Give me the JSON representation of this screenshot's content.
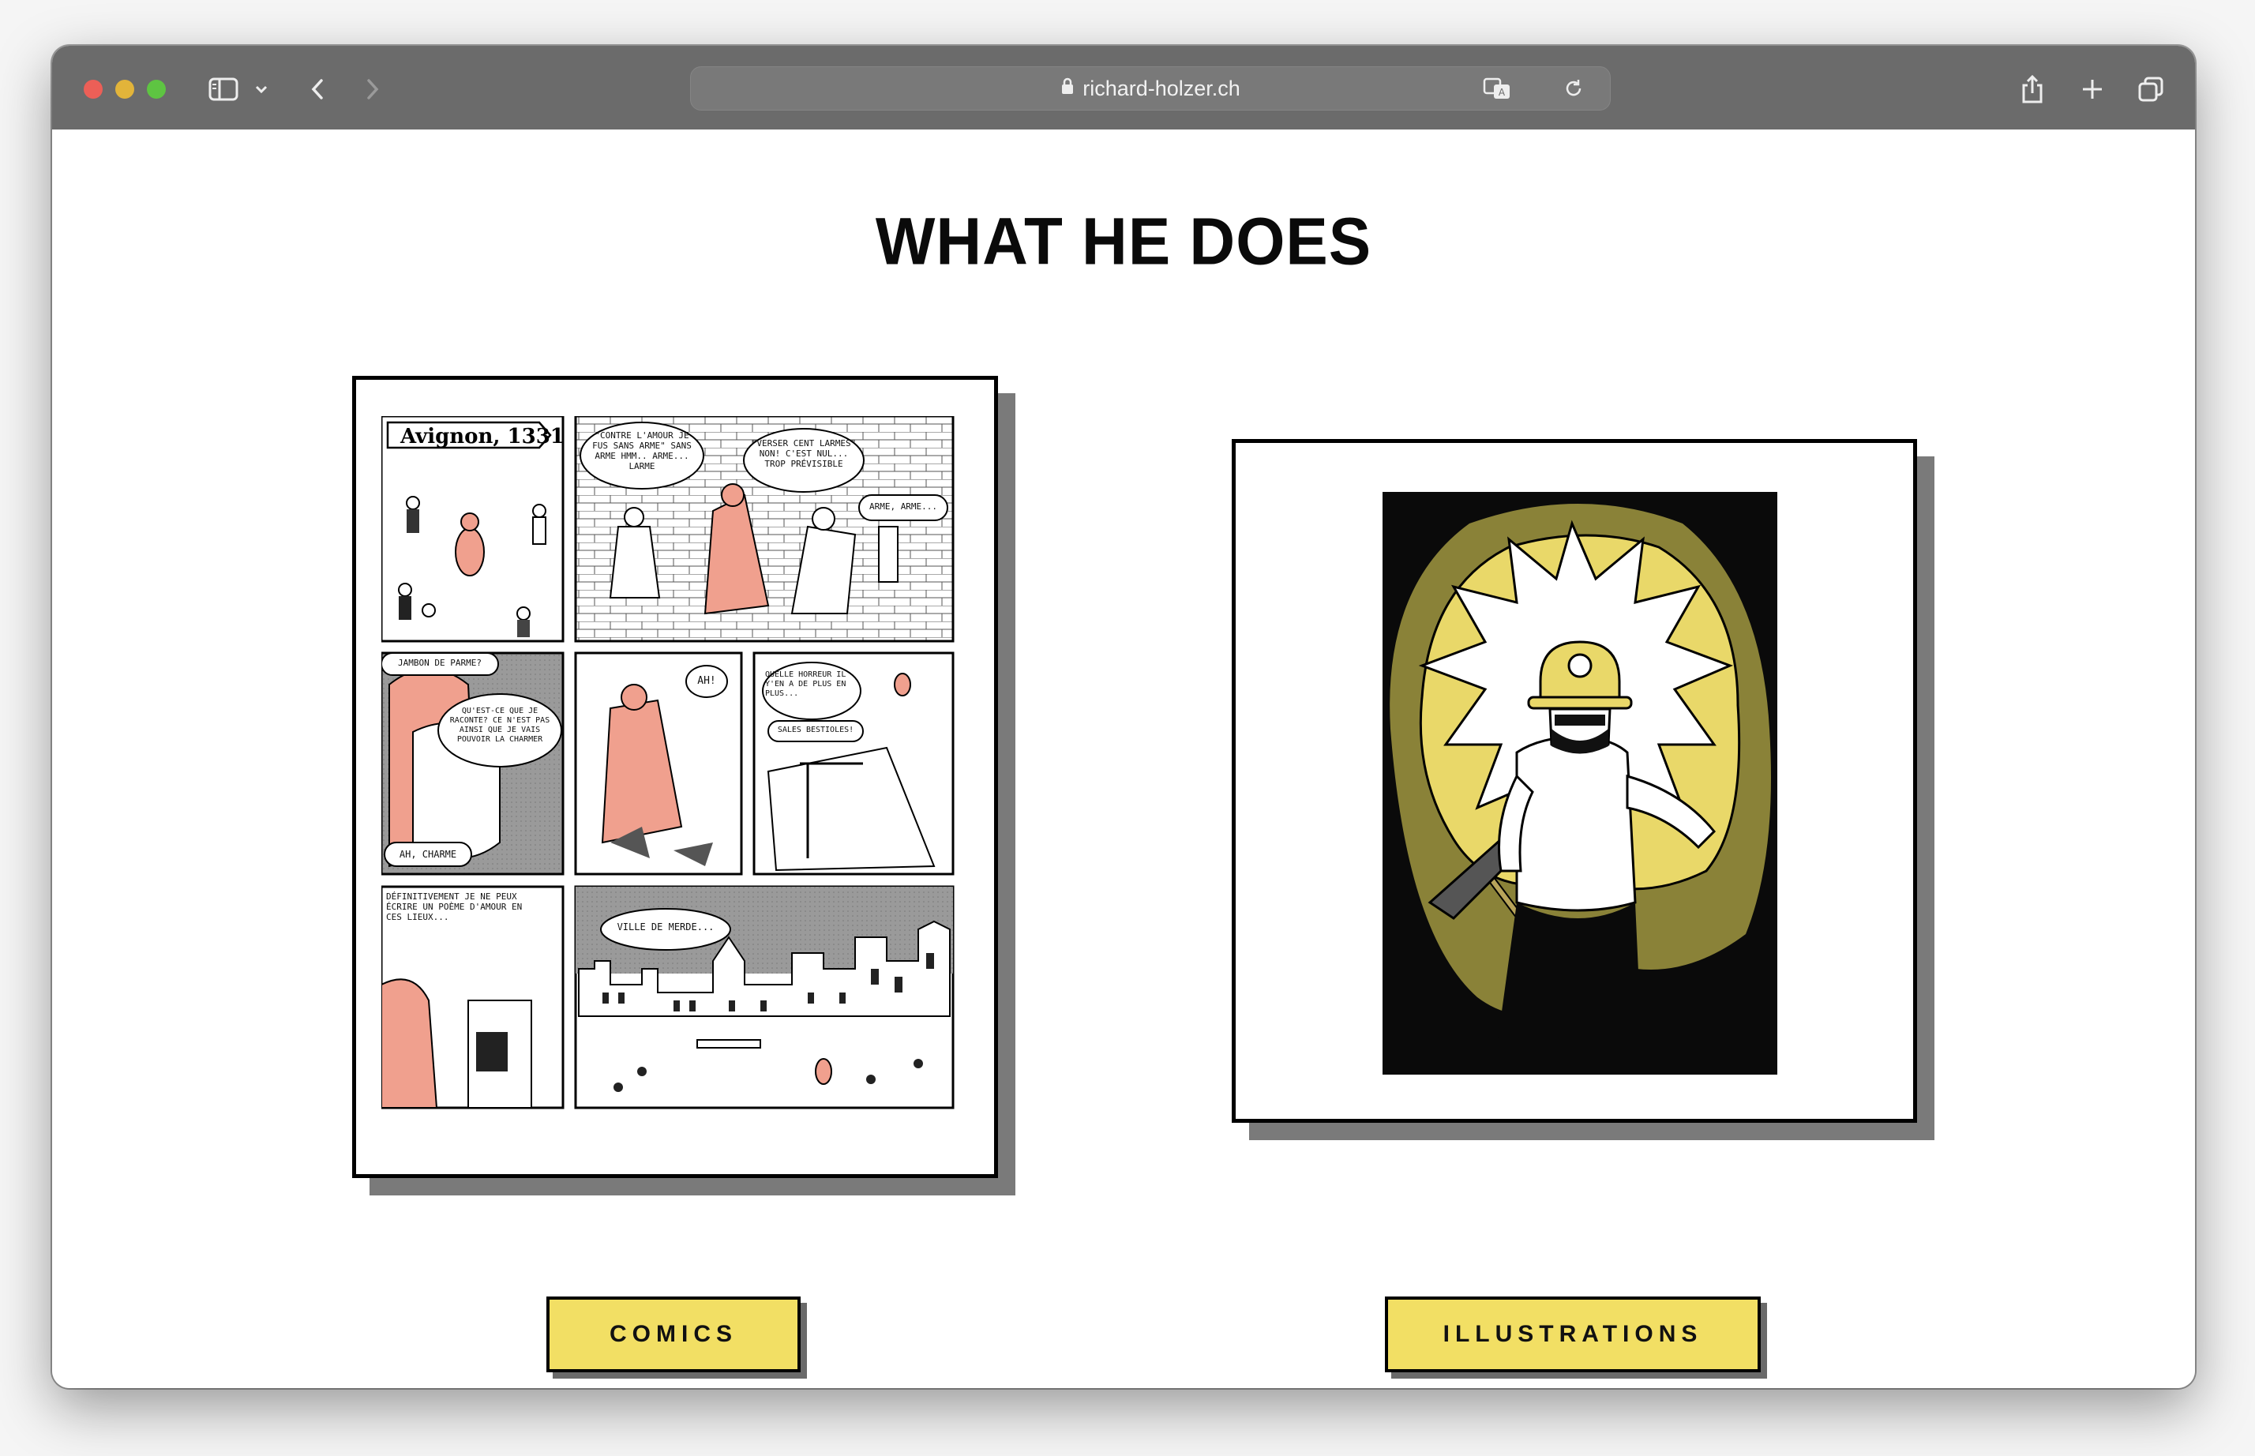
{
  "browser": {
    "url": "richard-holzer.ch",
    "icons": [
      "sidebar-icon",
      "chevron-down-icon",
      "back-icon",
      "forward-icon",
      "lock-icon",
      "translate-icon",
      "reload-icon",
      "share-icon",
      "plus-icon",
      "tabs-icon"
    ]
  },
  "page": {
    "heading": "WHAT HE DOES",
    "comics": {
      "button_label": "COMICS",
      "panel_texts": {
        "title": "Avignon, 1331",
        "bubble1": "\"CONTRE L'AMOUR JE FUS SANS ARME\" SANS ARME HMM.. ARME... LARME",
        "bubble2": "\"VERSER CENT LARMES\" NON! C'EST NUL... TROP PRÉVISIBLE",
        "bubble3": "ARME, ARME...",
        "bubble4": "JAMBON DE PARME?",
        "bubble5": "QU'EST-CE QUE JE RACONTE? CE N'EST PAS AINSI QUE JE VAIS POUVOIR LA CHARMER",
        "bubble6": "AH!",
        "bubble7": "QUELLE HORREUR IL Y'EN A DE PLUS EN PLUS...",
        "bubble8": "SALES BESTIOLES!",
        "bubble9": "AH, CHARME",
        "bubble10": "DÉFINITIVEMENT JE NE PEUX ÉCRIRE UN POÈME D'AMOUR EN CES LIEUX...",
        "bubble11": "VILLE DE MERDE..."
      }
    },
    "illustrations": {
      "button_label": "ILLUSTRATIONS"
    }
  },
  "colors": {
    "toolbar": "#6b6b6b",
    "button_yellow": "#f2df64",
    "shadow_gray": "#7a7a7a",
    "comic_salmon": "#f0a08e",
    "illus_yellow": "#e9d869"
  }
}
